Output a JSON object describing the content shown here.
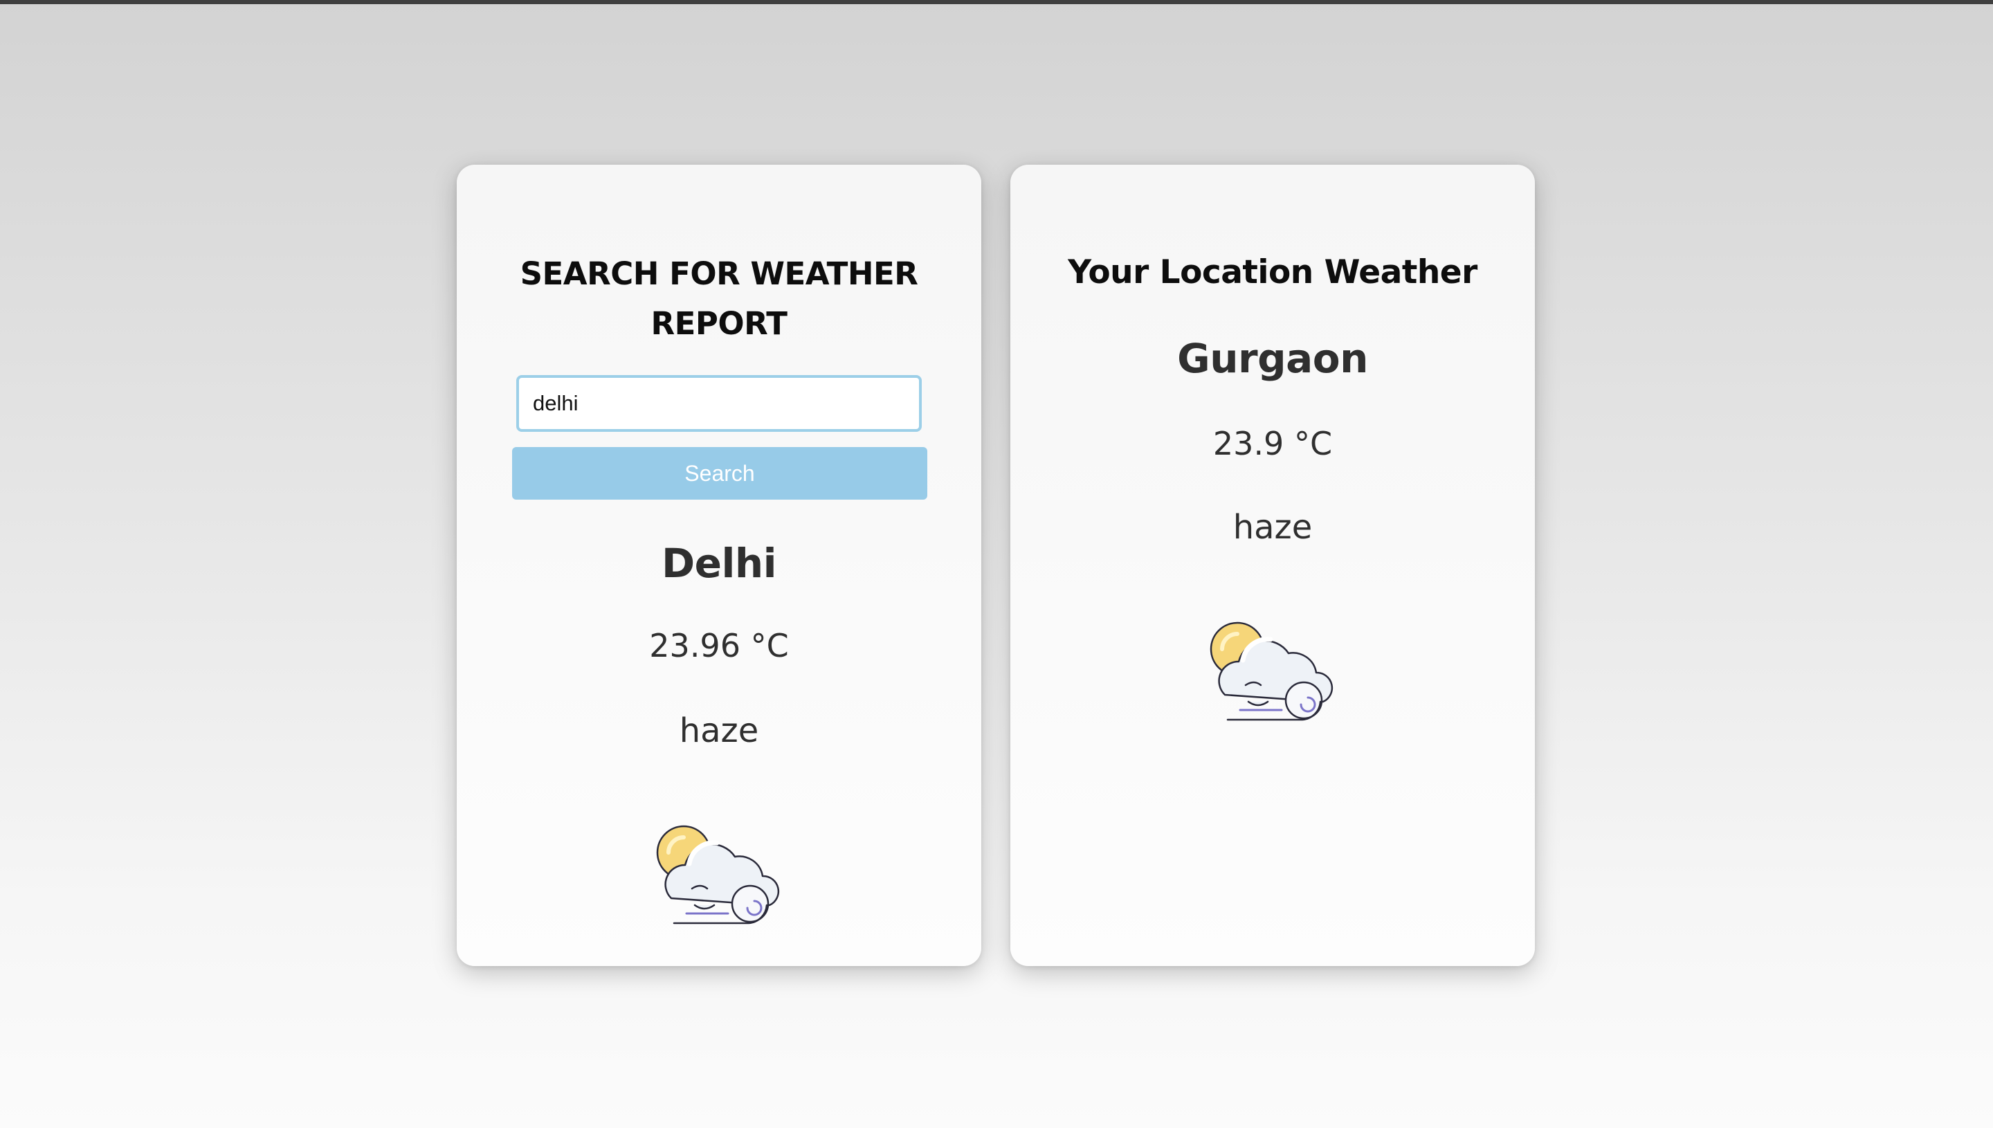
{
  "search_card": {
    "title": "SEARCH FOR WEATHER REPORT",
    "input_value": "delhi",
    "search_button_label": "Search",
    "result": {
      "city": "Delhi",
      "temperature": "23.96 °C",
      "condition": "haze",
      "icon": "haze-cloud-sun-wind-icon"
    }
  },
  "location_card": {
    "title": "Your Location Weather",
    "city": "Gurgaon",
    "temperature": "23.9 °C",
    "condition": "haze",
    "icon": "haze-cloud-sun-wind-icon"
  },
  "colors": {
    "accent": "#97cbe8",
    "input_border": "#9ccfe8",
    "sun": "#f6d679",
    "cloud": "#eef2f7",
    "wind": "#7b74c9",
    "text": "#2f2f2f"
  }
}
